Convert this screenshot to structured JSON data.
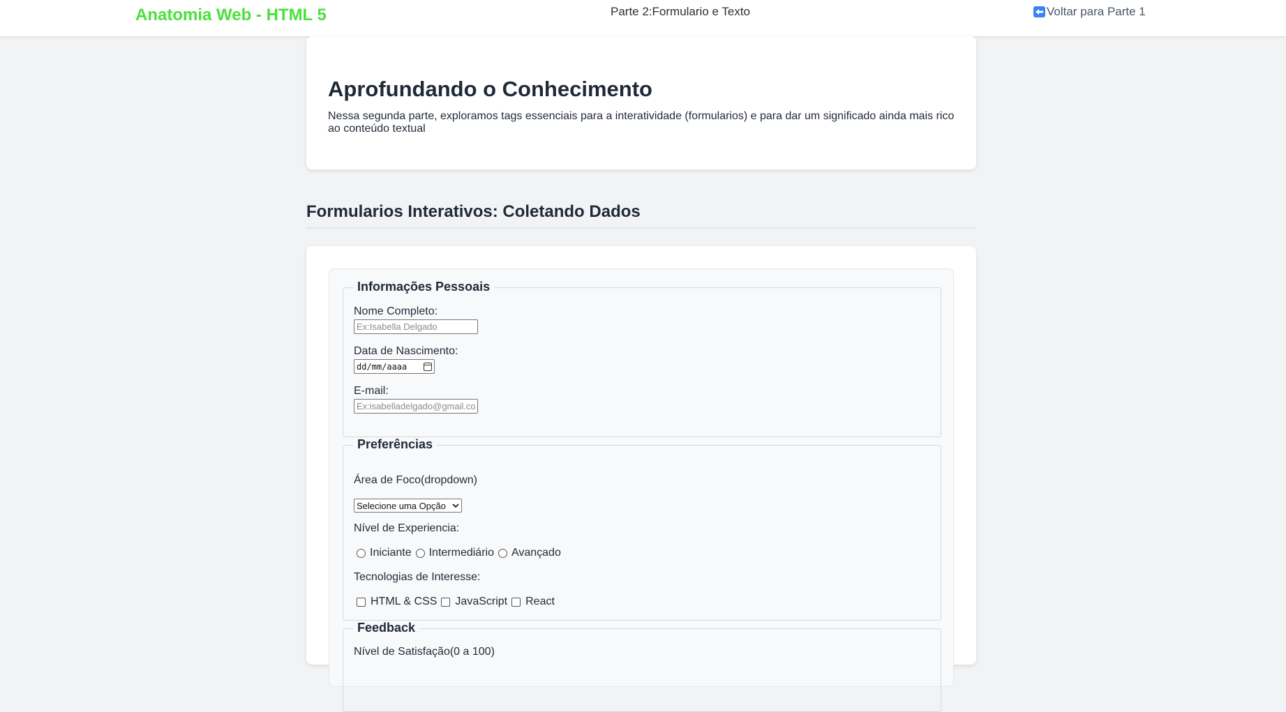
{
  "header": {
    "logo": "Anatomia Web - HTML 5",
    "center": "Parte 2:Formulario e Texto",
    "back_link": "Voltar para Parte 1"
  },
  "intro": {
    "title": "Aprofundando o Conhecimento",
    "text": "Nessa segunda parte, exploramos tags essenciais para a interatividade (formularios) e para dar um significado ainda mais rico ao conteúdo textual"
  },
  "forms_section": {
    "title": "Formularios Interativos: Coletando Dados"
  },
  "personal": {
    "legend": "Informações Pessoais",
    "name_label": "Nome Completo:",
    "name_placeholder": "Ex:Isabella Delgado",
    "birth_label": "Data de Nascimento:",
    "birth_value": "dd/mm/aaaa",
    "email_label": "E-mail:",
    "email_placeholder": "Ex:isabelladelgado@gmail.com"
  },
  "preferences": {
    "legend": "Preferências",
    "focus_label": "Área de Foco(dropdown)",
    "focus_selected": "Selecione uma Opção",
    "level_label": "Nível de Experiencia:",
    "levels": [
      "Iniciante",
      "Intermediário",
      "Avançado"
    ],
    "tech_label": "Tecnologias de Interesse:",
    "techs": [
      "HTML & CSS",
      "JavaScript",
      "React"
    ]
  },
  "feedback": {
    "legend": "Feedback",
    "satisfaction_label": "Nível de Satisfação(0 a 100)"
  }
}
